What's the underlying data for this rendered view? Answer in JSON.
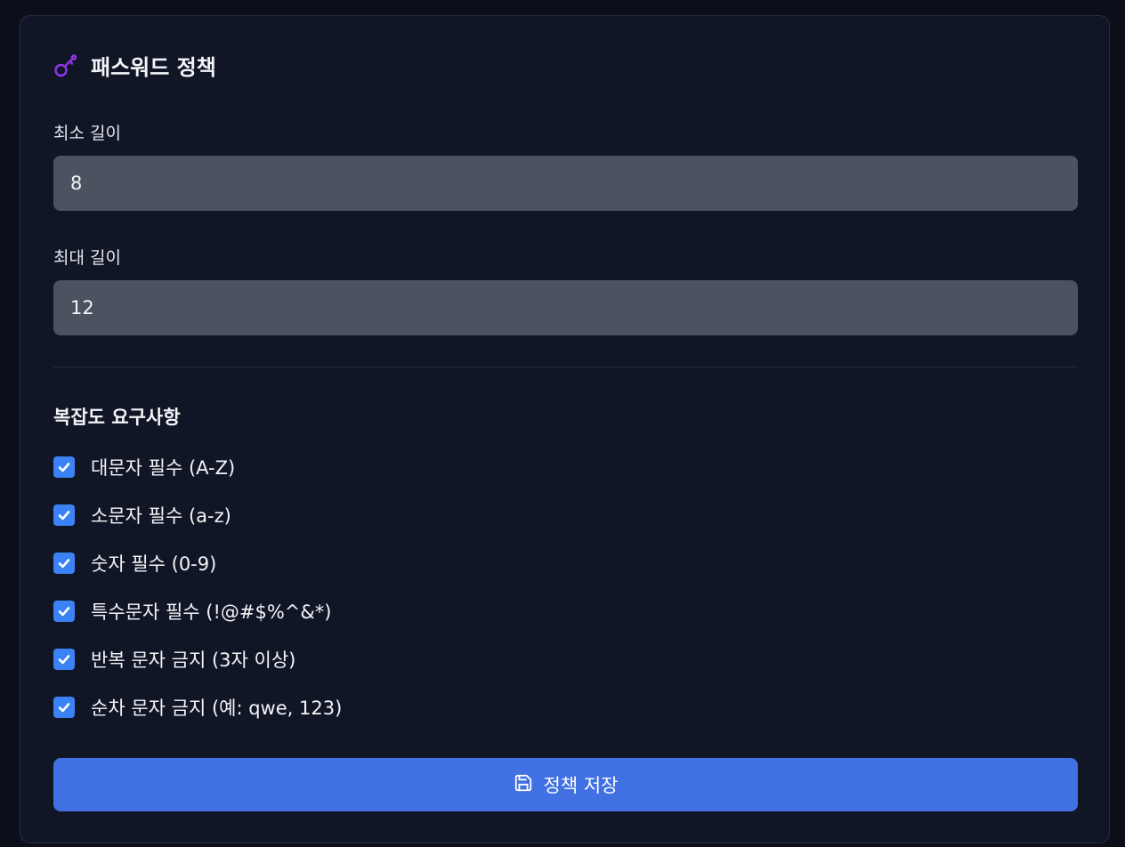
{
  "header": {
    "title": "패스워드 정책",
    "icon": "key-icon",
    "icon_color": "#9333ea"
  },
  "min_length": {
    "label": "최소 길이",
    "value": "8"
  },
  "max_length": {
    "label": "최대 길이",
    "value": "12"
  },
  "complexity": {
    "title": "복잡도 요구사항",
    "checkbox_color": "#3b82f6",
    "items": [
      {
        "label": "대문자 필수 (A-Z)",
        "checked": true
      },
      {
        "label": "소문자 필수 (a-z)",
        "checked": true
      },
      {
        "label": "숫자 필수 (0-9)",
        "checked": true
      },
      {
        "label": "특수문자 필수 (!@#$%^&*)",
        "checked": true
      },
      {
        "label": "반복 문자 금지 (3자 이상)",
        "checked": true
      },
      {
        "label": "순차 문자 금지 (예: qwe, 123)",
        "checked": true
      }
    ]
  },
  "actions": {
    "save_label": "정책 저장",
    "save_icon": "save-icon",
    "button_color": "#4170e2"
  }
}
